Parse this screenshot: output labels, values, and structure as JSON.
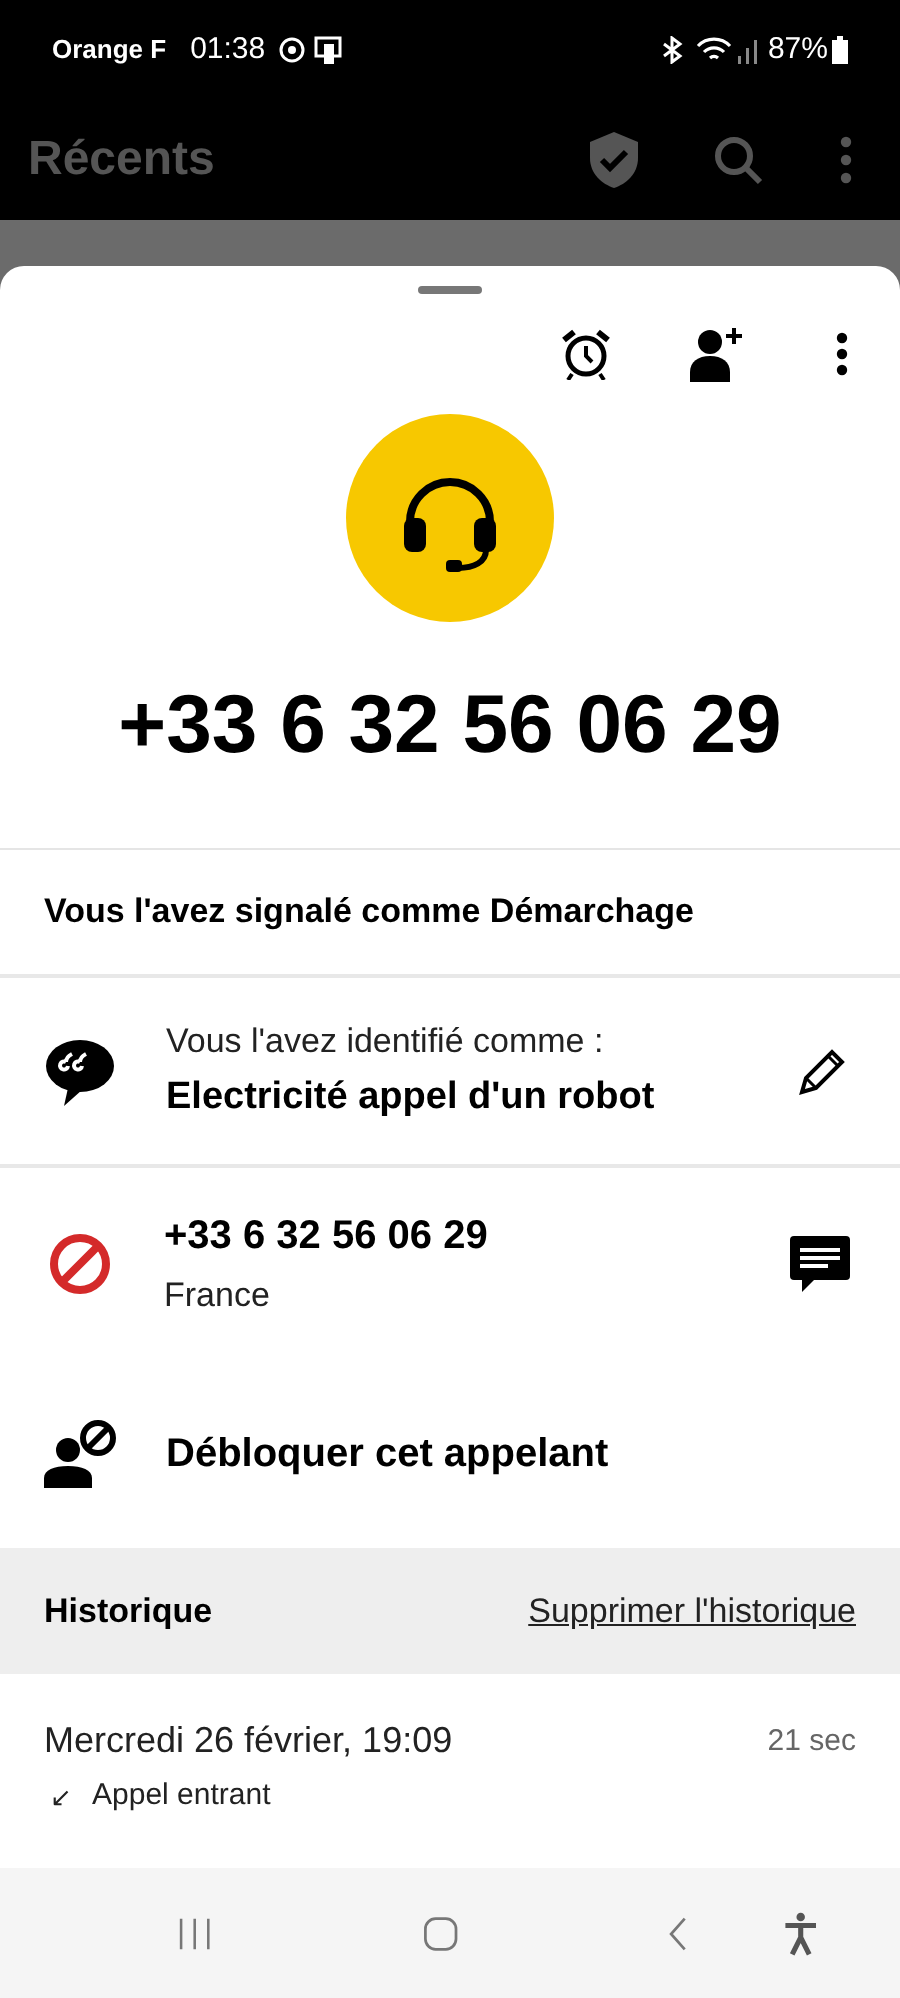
{
  "status_bar": {
    "carrier": "Orange F",
    "time": "01:38",
    "battery": "87%"
  },
  "app_bar": {
    "title": "Récents"
  },
  "caller": {
    "number": "+33 6 32 56 06 29"
  },
  "report": {
    "text": "Vous l'avez signalé comme Démarchage"
  },
  "identification": {
    "label": "Vous l'avez identifié comme :",
    "value": "Electricité appel d'un robot"
  },
  "number_row": {
    "number": "+33 6 32 56 06 29",
    "country": "France"
  },
  "unblock": {
    "label": "Débloquer cet appelant"
  },
  "history": {
    "title": "Historique",
    "clear_link": "Supprimer l'historique",
    "entries": [
      {
        "date": "Mercredi 26 février, 19:09",
        "direction_glyph": "↙",
        "type": "Appel entrant",
        "duration": "21 sec"
      }
    ]
  }
}
